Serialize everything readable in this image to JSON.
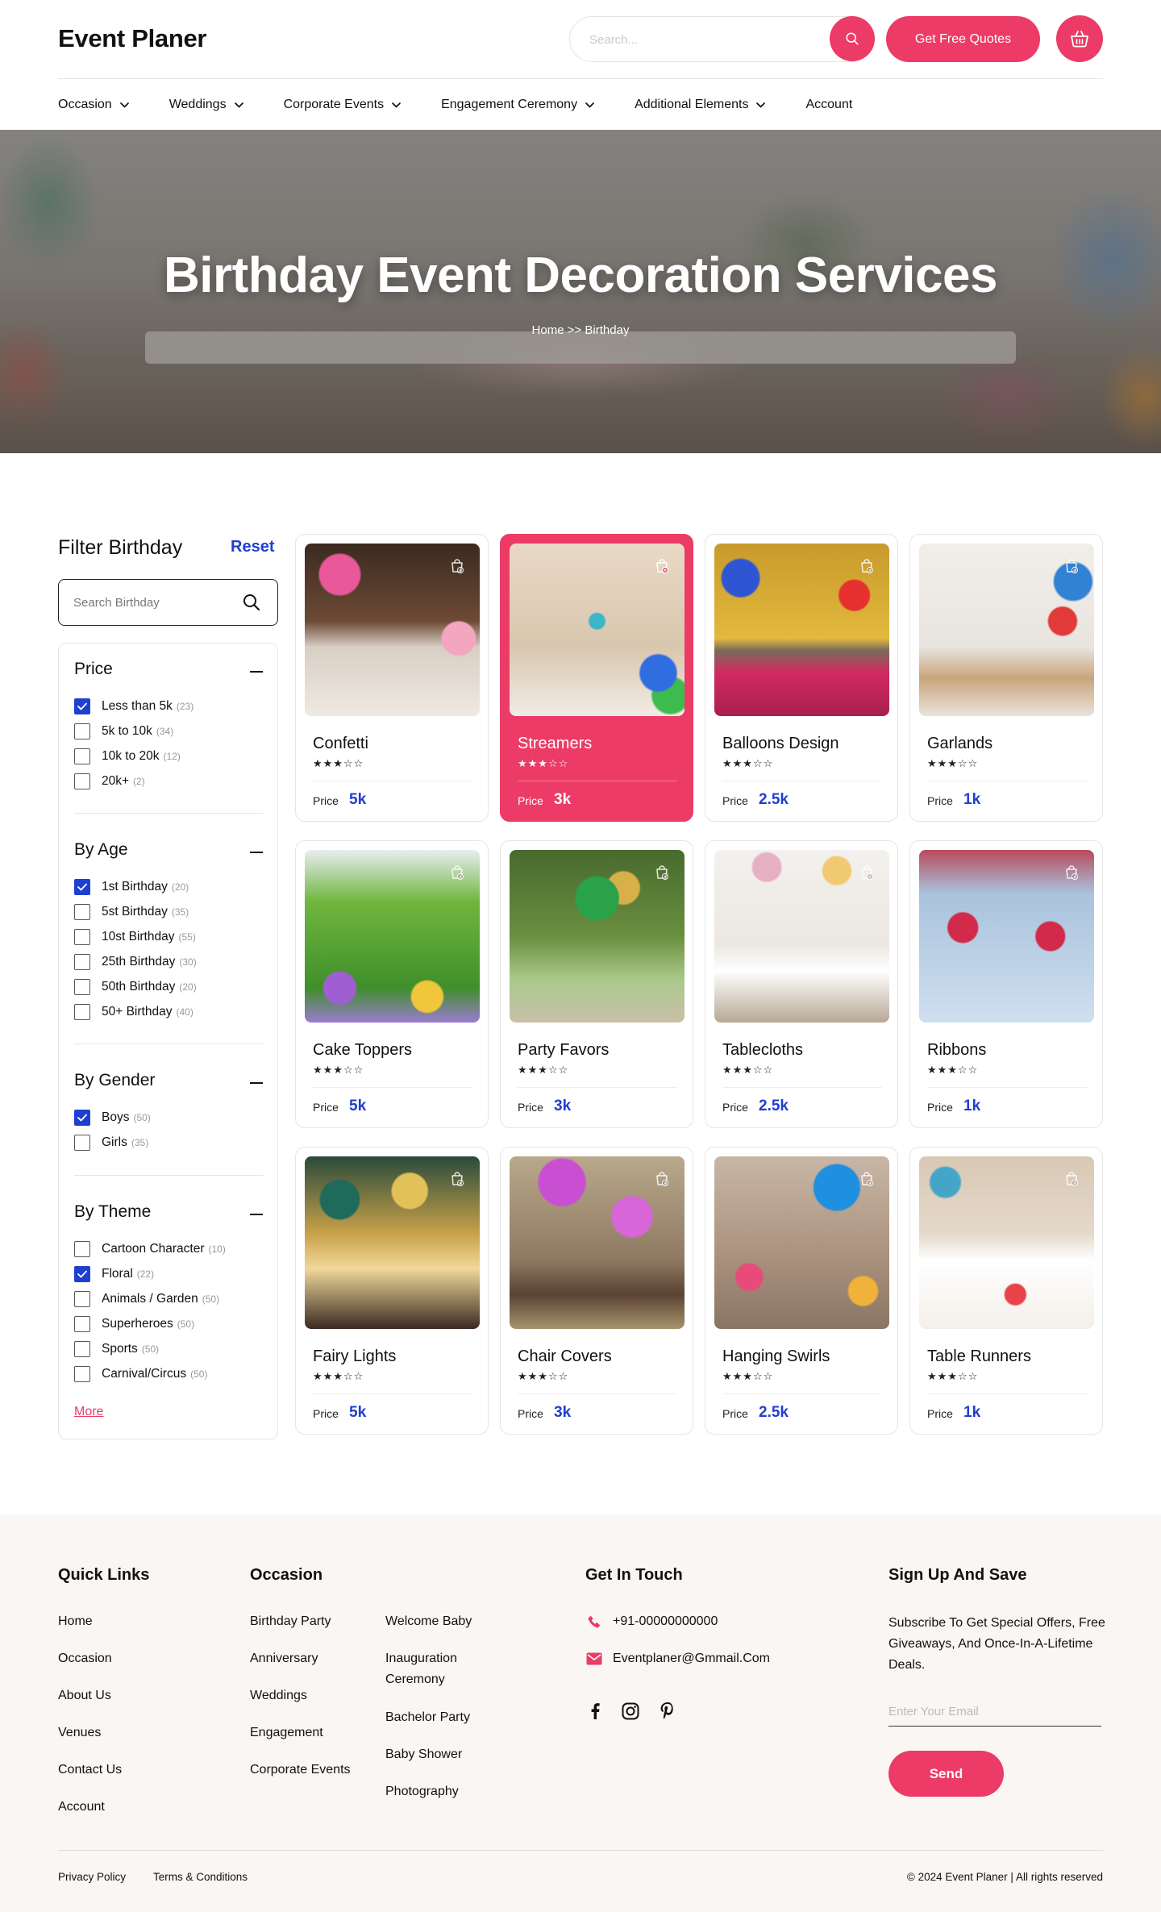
{
  "header": {
    "logo": "Event Planer",
    "search_placeholder": "Search...",
    "quotes_label": "Get Free Quotes",
    "brand_color": "#ec3b66",
    "nav": [
      {
        "label": "Occasion",
        "has_dropdown": true
      },
      {
        "label": "Weddings",
        "has_dropdown": true
      },
      {
        "label": "Corporate Events",
        "has_dropdown": true
      },
      {
        "label": "Engagement Ceremony",
        "has_dropdown": true
      },
      {
        "label": "Additional Elements",
        "has_dropdown": true
      },
      {
        "label": "Account",
        "has_dropdown": false
      }
    ]
  },
  "hero": {
    "title": "Birthday Event Decoration Services",
    "breadcrumb": "Home >> Birthday"
  },
  "filter": {
    "title": "Filter Birthday",
    "reset_label": "Reset",
    "search_placeholder": "Search Birthday",
    "accent_color": "#1f3fd1",
    "groups": [
      {
        "title": "Price",
        "options": [
          {
            "label": "Less than 5k",
            "count": "(23)",
            "checked": true
          },
          {
            "label": "5k to 10k",
            "count": "(34)",
            "checked": false
          },
          {
            "label": "10k to 20k",
            "count": "(12)",
            "checked": false
          },
          {
            "label": "20k+",
            "count": "(2)",
            "checked": false
          }
        ]
      },
      {
        "title": "By Age",
        "options": [
          {
            "label": "1st Birthday",
            "count": "(20)",
            "checked": true
          },
          {
            "label": "5st Birthday",
            "count": "(35)",
            "checked": false
          },
          {
            "label": "10st Birthday",
            "count": "(55)",
            "checked": false
          },
          {
            "label": "25th Birthday",
            "count": "(30)",
            "checked": false
          },
          {
            "label": "50th Birthday",
            "count": "(20)",
            "checked": false
          },
          {
            "label": "50+ Birthday",
            "count": "(40)",
            "checked": false
          }
        ]
      },
      {
        "title": "By Gender",
        "options": [
          {
            "label": "Boys",
            "count": "(50)",
            "checked": true
          },
          {
            "label": "Girls",
            "count": "(35)",
            "checked": false
          }
        ]
      },
      {
        "title": "By Theme",
        "options": [
          {
            "label": "Cartoon Character",
            "count": "(10)",
            "checked": false
          },
          {
            "label": "Floral",
            "count": "(22)",
            "checked": true
          },
          {
            "label": "Animals / Garden",
            "count": "(50)",
            "checked": false
          },
          {
            "label": "Superheroes",
            "count": "(50)",
            "checked": false
          },
          {
            "label": "Sports",
            "count": "(50)",
            "checked": false
          },
          {
            "label": "Carnival/Circus",
            "count": "(50)",
            "checked": false
          }
        ]
      }
    ],
    "more_label": "More"
  },
  "products": [
    {
      "name": "Confetti",
      "rating": 3,
      "price_label": "Price",
      "price": "5k",
      "active": false
    },
    {
      "name": "Streamers",
      "rating": 3,
      "price_label": "Price",
      "price": "3k",
      "active": true
    },
    {
      "name": "Balloons Design",
      "rating": 3,
      "price_label": "Price",
      "price": "2.5k",
      "active": false
    },
    {
      "name": "Garlands",
      "rating": 3,
      "price_label": "Price",
      "price": "1k",
      "active": false
    },
    {
      "name": "Cake Toppers",
      "rating": 3,
      "price_label": "Price",
      "price": "5k",
      "active": false
    },
    {
      "name": "Party Favors",
      "rating": 3,
      "price_label": "Price",
      "price": "3k",
      "active": false
    },
    {
      "name": "Tablecloths",
      "rating": 3,
      "price_label": "Price",
      "price": "2.5k",
      "active": false
    },
    {
      "name": "Ribbons",
      "rating": 3,
      "price_label": "Price",
      "price": "1k",
      "active": false
    },
    {
      "name": "Fairy Lights",
      "rating": 3,
      "price_label": "Price",
      "price": "5k",
      "active": false
    },
    {
      "name": "Chair Covers",
      "rating": 3,
      "price_label": "Price",
      "price": "3k",
      "active": false
    },
    {
      "name": "Hanging Swirls",
      "rating": 3,
      "price_label": "Price",
      "price": "2.5k",
      "active": false
    },
    {
      "name": "Table Runners",
      "rating": 3,
      "price_label": "Price",
      "price": "1k",
      "active": false
    }
  ],
  "footer": {
    "quick_links_title": "Quick Links",
    "quick_links": [
      "Home",
      "Occasion",
      "About Us",
      "Venues",
      "Contact Us",
      "Account"
    ],
    "occasion_title": "Occasion",
    "occasion_col1": [
      "Birthday Party",
      "Anniversary",
      "Weddings",
      "Engagement",
      "Corporate Events"
    ],
    "occasion_col2": [
      "Welcome Baby",
      "Inauguration Ceremony",
      "Bachelor Party",
      "Baby Shower",
      "Photography"
    ],
    "contact_title": "Get In Touch",
    "phone": "+91-00000000000",
    "email": "Eventplaner@Gmmail.Com",
    "social_icons": [
      "facebook-icon",
      "instagram-icon",
      "pinterest-icon"
    ],
    "signup_title": "Sign Up And Save",
    "signup_text": "Subscribe To Get Special Offers, Free Giveaways, And Once-In-A-Lifetime Deals.",
    "email_placeholder": "Enter Your Email",
    "send_label": "Send",
    "privacy": "Privacy Policy",
    "terms": "Terms & Conditions",
    "copyright": "© 2024 Event Planer | All rights reserved"
  }
}
